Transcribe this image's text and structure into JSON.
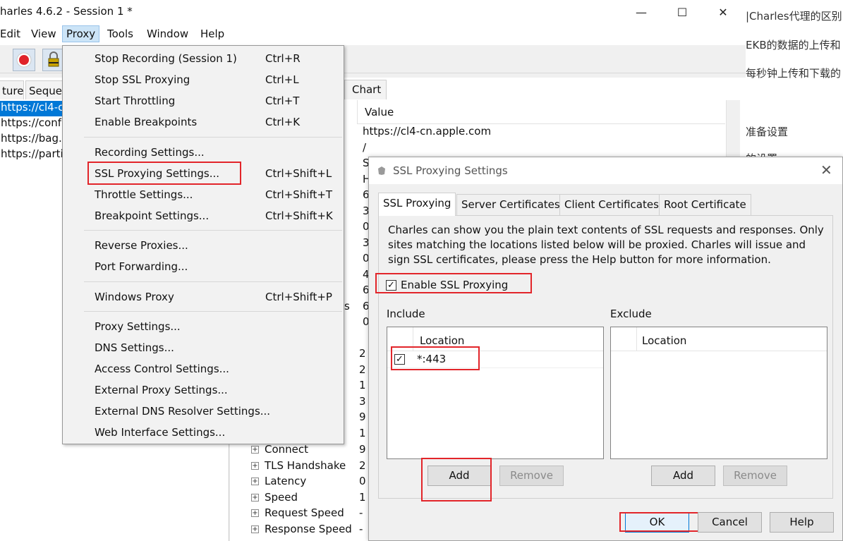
{
  "window": {
    "title": "harles 4.6.2 - Session 1 *",
    "minimize_glyph": "—",
    "maximize_glyph": "☐",
    "close_glyph": "✕"
  },
  "menubar": [
    "Edit",
    "View",
    "Proxy",
    "Tools",
    "Window",
    "Help"
  ],
  "left_pane": {
    "tabs": [
      "ture",
      "Seque"
    ],
    "rows": [
      "https://cl4-c",
      "https://conf",
      "https://bag.",
      "https://parti"
    ]
  },
  "detail": {
    "chart_tab": "Chart",
    "value_header": "Value",
    "values": [
      "https://cl4-cn.apple.com",
      "/",
      "S",
      "H",
      "6",
      "3",
      "0",
      "3",
      "0",
      "4",
      "6",
      "6",
      "0"
    ],
    "numbers_lower": [
      "2",
      "2",
      "1",
      "3",
      "9",
      "1",
      "9",
      "2",
      "0",
      "1",
      "-",
      "-"
    ],
    "partial_label": "s",
    "tree_rows": [
      "Connect",
      "TLS Handshake",
      "Latency",
      "Speed",
      "Request Speed",
      "Response Speed"
    ]
  },
  "background_app": {
    "lines": [
      "|Charles代理的区别",
      "EKB的数据的上传和",
      "每秒钟上传和下载的",
      "准备设置",
      "的设置"
    ]
  },
  "proxy_menu": {
    "groups": [
      [
        {
          "label": "Stop Recording (Session 1)",
          "shortcut": "Ctrl+R"
        },
        {
          "label": "Stop SSL Proxying",
          "shortcut": "Ctrl+L"
        },
        {
          "label": "Start Throttling",
          "shortcut": "Ctrl+T"
        },
        {
          "label": "Enable Breakpoints",
          "shortcut": "Ctrl+K"
        }
      ],
      [
        {
          "label": "Recording Settings...",
          "shortcut": ""
        },
        {
          "label": "SSL Proxying Settings...",
          "shortcut": "Ctrl+Shift+L"
        },
        {
          "label": "Throttle Settings...",
          "shortcut": "Ctrl+Shift+T"
        },
        {
          "label": "Breakpoint Settings...",
          "shortcut": "Ctrl+Shift+K"
        }
      ],
      [
        {
          "label": "Reverse Proxies...",
          "shortcut": ""
        },
        {
          "label": "Port Forwarding...",
          "shortcut": ""
        }
      ],
      [
        {
          "label": "Windows Proxy",
          "shortcut": "Ctrl+Shift+P"
        }
      ],
      [
        {
          "label": "Proxy Settings...",
          "shortcut": ""
        },
        {
          "label": "DNS Settings...",
          "shortcut": ""
        },
        {
          "label": "Access Control Settings...",
          "shortcut": ""
        },
        {
          "label": "External Proxy Settings...",
          "shortcut": ""
        },
        {
          "label": "External DNS Resolver Settings...",
          "shortcut": ""
        },
        {
          "label": "Web Interface Settings...",
          "shortcut": ""
        }
      ]
    ]
  },
  "ssl_dialog": {
    "title": "SSL Proxying Settings",
    "close_glyph": "✕",
    "tabs": [
      "SSL Proxying",
      "Server Certificates",
      "Client Certificates",
      "Root Certificate"
    ],
    "description": "Charles can show you the plain text contents of SSL requests and responses. Only sites matching the locations listed below will be proxied. Charles will issue and sign SSL certificates, please press the Help button for more information.",
    "enable_label": "Enable SSL Proxying",
    "enable_checked": true,
    "include": {
      "title": "Include",
      "column": "Location",
      "rows": [
        {
          "checked": true,
          "location": "*:443"
        }
      ],
      "add": "Add",
      "remove": "Remove"
    },
    "exclude": {
      "title": "Exclude",
      "column": "Location",
      "rows": [],
      "add": "Add",
      "remove": "Remove"
    },
    "buttons": {
      "ok": "OK",
      "cancel": "Cancel",
      "help": "Help"
    }
  },
  "colors": {
    "selection": "#0078d7",
    "annotation_red": "#e2252a",
    "menu_bg": "#f2f2f2",
    "dialog_bg": "#f0f0f0"
  },
  "icons": {
    "check": "✓",
    "plus": "+",
    "record": "record-icon",
    "ssl_lock": "lock-icon"
  }
}
